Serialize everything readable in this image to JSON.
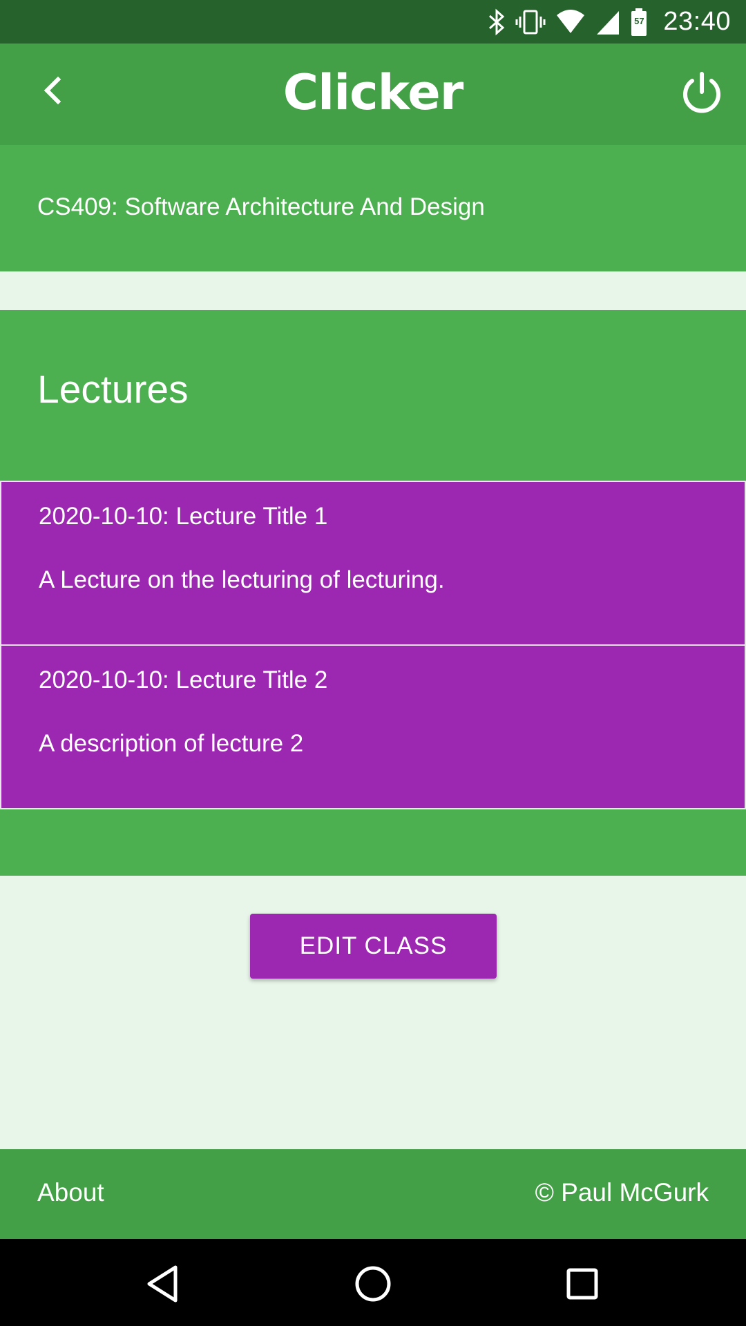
{
  "status_bar": {
    "time": "23:40",
    "battery_level": "57",
    "icons": [
      "bluetooth-icon",
      "vibrate-icon",
      "wifi-icon",
      "cell-signal-icon",
      "battery-icon"
    ]
  },
  "app_bar": {
    "title": "Clicker",
    "back_icon": "chevron-left-icon",
    "power_icon": "power-icon"
  },
  "course": {
    "title": "CS409: Software Architecture And Design"
  },
  "lectures": {
    "heading": "Lectures",
    "items": [
      {
        "title": "2020-10-10: Lecture Title 1",
        "description": "A Lecture on the lecturing of lecturing."
      },
      {
        "title": "2020-10-10: Lecture Title 2",
        "description": "A description of lecture 2"
      }
    ]
  },
  "actions": {
    "edit_class_label": "EDIT CLASS"
  },
  "footer": {
    "about_label": "About",
    "copyright": "© Paul McGurk"
  },
  "nav_bar": {
    "icons": [
      "back-triangle-icon",
      "home-circle-icon",
      "recents-square-icon"
    ]
  },
  "colors": {
    "status_bar": "#26622c",
    "app_bar": "#43a047",
    "panel": "#4caf50",
    "accent": "#9c27b0",
    "background": "#e8f5e9"
  }
}
